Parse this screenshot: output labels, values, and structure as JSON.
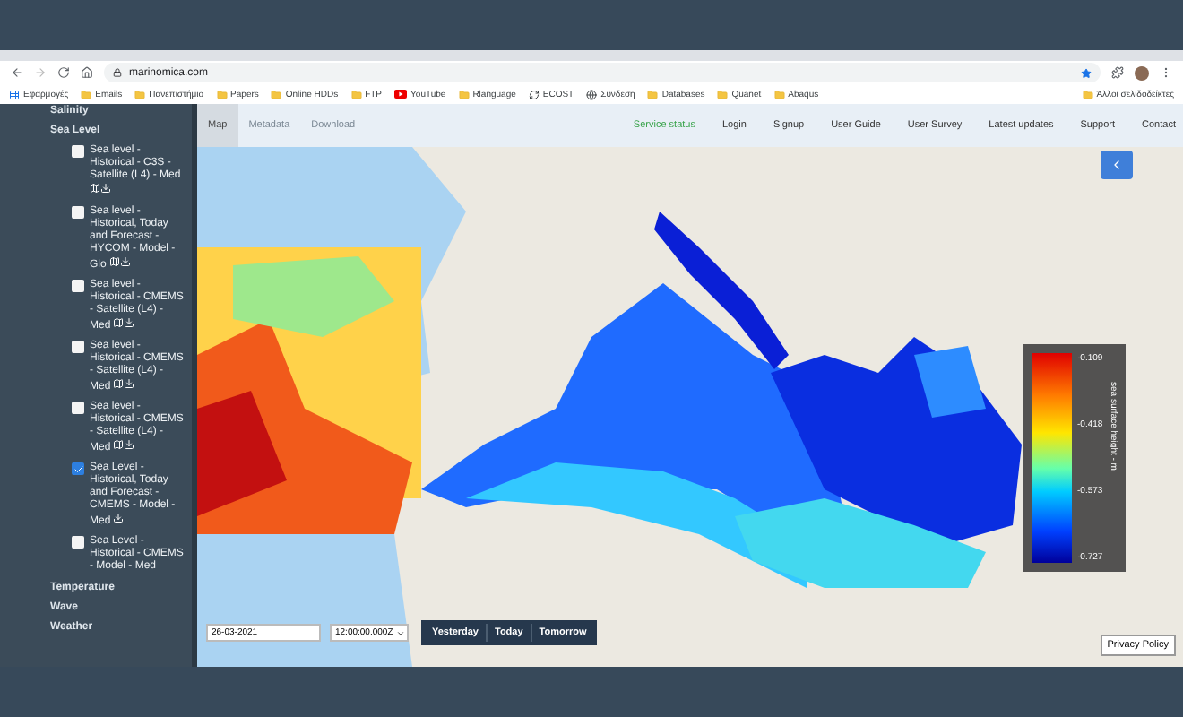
{
  "browser": {
    "address": "marinomica.com",
    "bookmarks": [
      {
        "label": "Εφαρμογές",
        "kind": "apps"
      },
      {
        "label": "Emails",
        "kind": "folder"
      },
      {
        "label": "Πανεπιστήμιο",
        "kind": "folder"
      },
      {
        "label": "Papers",
        "kind": "folder"
      },
      {
        "label": "Online HDDs",
        "kind": "folder"
      },
      {
        "label": "FTP",
        "kind": "folder"
      },
      {
        "label": "YouTube",
        "kind": "video"
      },
      {
        "label": "Rlanguage",
        "kind": "folder"
      },
      {
        "label": "ECOST",
        "kind": "sync"
      },
      {
        "label": "Σύνδεση",
        "kind": "globe"
      },
      {
        "label": "Databases",
        "kind": "folder"
      },
      {
        "label": "Quanet",
        "kind": "folder"
      },
      {
        "label": "Abaqus",
        "kind": "folder"
      }
    ],
    "other_bookmarks": "Άλλοι σελιδοδείκτες"
  },
  "sidebar": {
    "groups": [
      {
        "label": "Salinity"
      },
      {
        "label": "Sea Level",
        "items": [
          {
            "label": "Sea level - Historical - C3S - Satellite (L4) - Med",
            "checked": false,
            "map_link": true,
            "download_link": true
          },
          {
            "label": "Sea level - Historical, Today and Forecast - HYCOM - Model - Glo",
            "checked": false,
            "map_link": true,
            "download_link": true
          },
          {
            "label": "Sea level - Historical - CMEMS - Satellite (L4) - Med",
            "checked": false,
            "map_link": true,
            "download_link": true
          },
          {
            "label": "Sea level - Historical - CMEMS - Satellite (L4) - Med",
            "checked": false,
            "map_link": true,
            "download_link": true
          },
          {
            "label": "Sea level - Historical - CMEMS - Satellite (L4) - Med",
            "checked": false,
            "map_link": true,
            "download_link": true
          },
          {
            "label": "Sea Level - Historical, Today and Forecast - CMEMS - Model - Med",
            "checked": true,
            "map_link": false,
            "download_link": true
          },
          {
            "label": "Sea Level - Historical - CMEMS - Model - Med",
            "checked": false,
            "map_link": false,
            "download_link": false
          }
        ]
      },
      {
        "label": "Temperature"
      },
      {
        "label": "Wave"
      },
      {
        "label": "Weather"
      }
    ]
  },
  "map_nav": {
    "tabs": [
      {
        "label": "Map",
        "selected": true
      },
      {
        "label": "Metadata",
        "selected": false
      },
      {
        "label": "Download",
        "selected": false
      }
    ],
    "links": [
      {
        "label": "Service status",
        "kind": "status"
      },
      {
        "label": "Login",
        "kind": "link"
      },
      {
        "label": "Signup",
        "kind": "link"
      },
      {
        "label": "User Guide",
        "kind": "link"
      },
      {
        "label": "User Survey",
        "kind": "link"
      },
      {
        "label": "Latest updates",
        "kind": "link"
      },
      {
        "label": "Support",
        "kind": "link"
      },
      {
        "label": "Contact",
        "kind": "link"
      }
    ]
  },
  "legend": {
    "title": "sea surface height - m",
    "labels": [
      "-0.109",
      "-0.418",
      "-0.573",
      "-0.727"
    ]
  },
  "time_controls": {
    "date": "26-03-2021",
    "time": "12:00:00.000Z",
    "buttons": [
      "Yesterday",
      "Today",
      "Tomorrow"
    ]
  },
  "privacy_button": "Privacy Policy"
}
